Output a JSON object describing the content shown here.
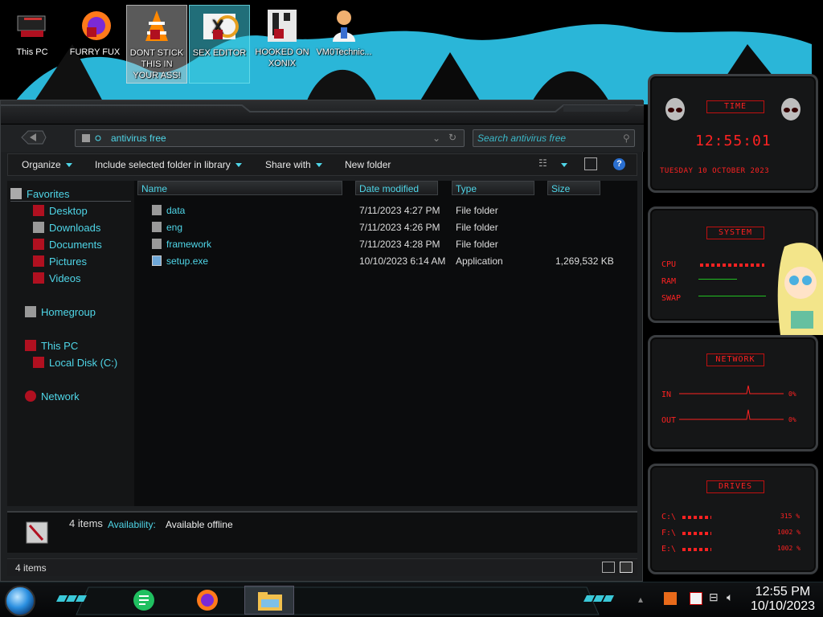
{
  "desktop": {
    "icons": [
      {
        "label": "This PC"
      },
      {
        "label": "FURRY FUX"
      },
      {
        "label": "DONT STICK THIS IN YOUR ASS!"
      },
      {
        "label": "SEX EDITOR"
      },
      {
        "label": "HOOKED ON XONIX"
      },
      {
        "label": "VM0Technic..."
      }
    ]
  },
  "explorer": {
    "address": "antivirus free",
    "search_placeholder": "Search antivirus free",
    "toolbar": {
      "organize": "Organize",
      "include": "Include selected folder in library",
      "share": "Share with",
      "new_folder": "New folder"
    },
    "nav": {
      "favorites": "Favorites",
      "desktop": "Desktop",
      "downloads": "Downloads",
      "documents": "Documents",
      "pictures": "Pictures",
      "videos": "Videos",
      "homegroup": "Homegroup",
      "this_pc": "This PC",
      "local_disk": "Local Disk (C:)",
      "network": "Network"
    },
    "columns": {
      "name": "Name",
      "date": "Date modified",
      "type": "Type",
      "size": "Size"
    },
    "files": [
      {
        "name": "data",
        "date": "7/11/2023 4:27 PM",
        "type": "File folder",
        "size": ""
      },
      {
        "name": "eng",
        "date": "7/11/2023 4:26 PM",
        "type": "File folder",
        "size": ""
      },
      {
        "name": "framework",
        "date": "7/11/2023 4:28 PM",
        "type": "File folder",
        "size": ""
      },
      {
        "name": "setup.exe",
        "date": "10/10/2023 6:14 AM",
        "type": "Application",
        "size": "1,269,532 KB"
      }
    ],
    "details": {
      "count": "4 items",
      "availability_label": "Availability:",
      "availability_value": "Available offline"
    },
    "status": {
      "count": "4 items"
    }
  },
  "gadgets": {
    "time": {
      "title": "TIME",
      "clock": "12:55:01",
      "date": "TUESDAY 10 OCTOBER 2023"
    },
    "system": {
      "title": "SYSTEM",
      "cpu": "CPU",
      "ram": "RAM",
      "swap": "SWAP"
    },
    "network": {
      "title": "NETWORK",
      "in_label": "IN",
      "out_label": "OUT",
      "in_val": "0%",
      "out_val": "0%"
    },
    "drives": {
      "title": "DRIVES",
      "rows": [
        {
          "label": "C:\\",
          "val": "315 %"
        },
        {
          "label": "F:\\",
          "val": "1002 %"
        },
        {
          "label": "E:\\",
          "val": "1002 %"
        }
      ]
    }
  },
  "taskbar": {
    "time": "12:55 PM",
    "date": "10/10/2023"
  },
  "colors": {
    "accent": "#4fd6e8",
    "gadget_red": "#ff2222"
  }
}
